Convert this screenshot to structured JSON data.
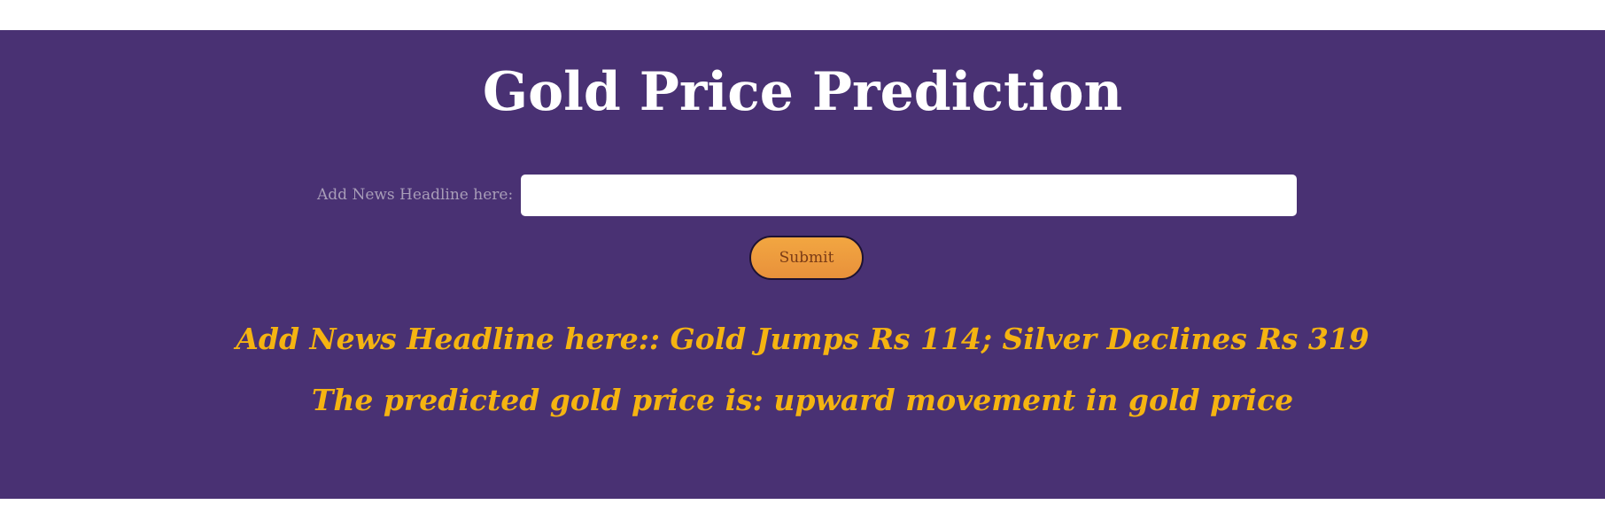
{
  "header": {
    "title": "Gold Price Prediction"
  },
  "form": {
    "input_label": "Add News Headline here:",
    "input_value": "",
    "input_placeholder": "",
    "submit_label": "Submit"
  },
  "result": {
    "headline_text": "Add News Headline here:: Gold Jumps Rs 114; Silver Declines Rs 319",
    "prediction_text": "The predicted gold price is: upward movement in gold price"
  },
  "colors": {
    "banner_background": "#493173",
    "title_text": "#ffffff",
    "result_text": "#f5b411",
    "button_background": "#f2a641"
  }
}
